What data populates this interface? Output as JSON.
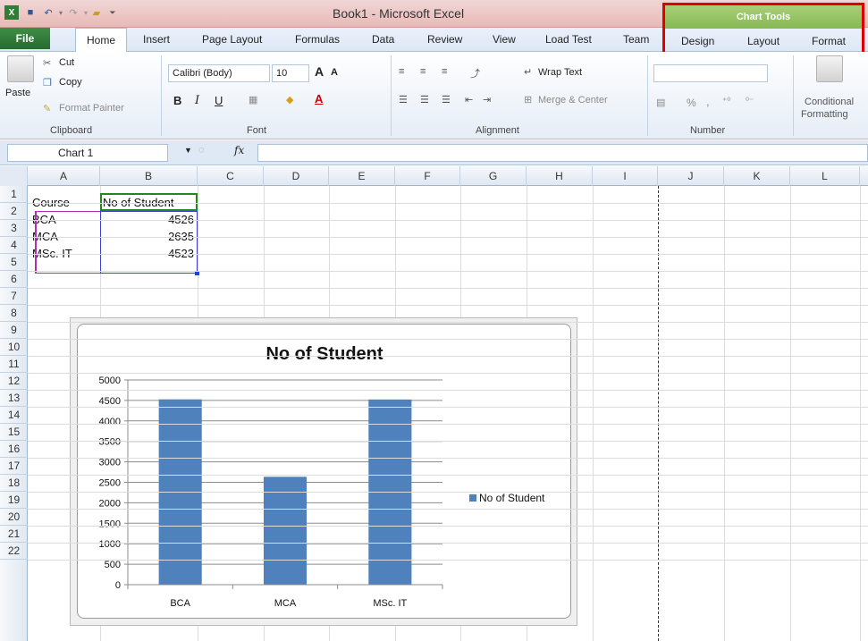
{
  "window": {
    "title": "Book1 - Microsoft Excel"
  },
  "ribbon_tabs": [
    "File",
    "Home",
    "Insert",
    "Page Layout",
    "Formulas",
    "Data",
    "Review",
    "View",
    "Load Test",
    "Team"
  ],
  "chart_tools": {
    "header": "Chart Tools",
    "tabs": [
      "Design",
      "Layout",
      "Format"
    ]
  },
  "clipboard": {
    "paste": "Paste",
    "cut": "Cut",
    "copy": "Copy",
    "format_painter": "Format Painter",
    "label": "Clipboard"
  },
  "font": {
    "family": "Calibri (Body)",
    "size": "10",
    "label": "Font",
    "bold": "B",
    "italic": "I",
    "underline": "U"
  },
  "alignment": {
    "wrap_text": "Wrap Text",
    "merge_center": "Merge & Center",
    "label": "Alignment"
  },
  "number": {
    "percent": "%",
    "comma": ",",
    "label": "Number"
  },
  "styles": {
    "conditional": "Conditional",
    "formatting": "Formatting"
  },
  "formula_bar": {
    "name_box": "Chart 1",
    "fx": "fx",
    "value": ""
  },
  "columns": [
    "A",
    "B",
    "C",
    "D",
    "E",
    "F",
    "G",
    "H",
    "I",
    "J",
    "K",
    "L"
  ],
  "rows": [
    "1",
    "2",
    "3",
    "4",
    "5",
    "6",
    "7",
    "8",
    "9",
    "10",
    "11",
    "12",
    "13",
    "14",
    "15",
    "16",
    "17",
    "18",
    "19",
    "20",
    "21",
    "22"
  ],
  "cells": {
    "A1": "Course",
    "B1": "No of Student",
    "A2": "BCA",
    "B2": "4526",
    "A3": "MCA",
    "B3": "2635",
    "A4": "MSc. IT",
    "B4": "4523"
  },
  "colors": {
    "bar": "#4f81bd",
    "highlight": "#e00000",
    "chart_tools": "#8cbf59",
    "file_tab": "#2f7d37"
  },
  "chart_data": {
    "type": "bar",
    "title": "No of Student",
    "categories": [
      "BCA",
      "MCA",
      "MSc. IT"
    ],
    "series": [
      {
        "name": "No of Student",
        "values": [
          4526,
          2635,
          4523
        ]
      }
    ],
    "ylim": [
      0,
      5000
    ],
    "yticks": [
      0,
      500,
      1000,
      1500,
      2000,
      2500,
      3000,
      3500,
      4000,
      4500,
      5000
    ],
    "grid": true,
    "legend": "right"
  }
}
